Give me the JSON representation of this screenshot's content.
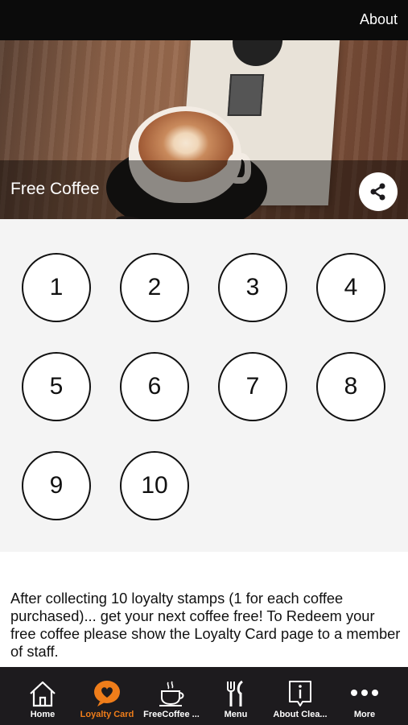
{
  "header": {
    "about_label": "About"
  },
  "hero": {
    "title": "Free Coffee",
    "share_icon": "share-icon"
  },
  "stamps": [
    "1",
    "2",
    "3",
    "4",
    "5",
    "6",
    "7",
    "8",
    "9",
    "10"
  ],
  "description": "After collecting 10 loyalty stamps (1 for each coffee purchased)... get your next coffee free! To Redeem your free coffee please show the Loyalty Card page to a member of staff.",
  "tab_bar": {
    "active_color": "#ef7d1a",
    "tabs": [
      {
        "label": "Home",
        "icon": "home-icon"
      },
      {
        "label": "Loyalty Card",
        "icon": "heart-bubble-icon",
        "active": true
      },
      {
        "label": "FreeCoffee ...",
        "icon": "coffee-cup-icon"
      },
      {
        "label": "Menu",
        "icon": "fork-knife-icon"
      },
      {
        "label": "About Clea...",
        "icon": "info-icon"
      },
      {
        "label": "More",
        "icon": "more-dots-icon"
      }
    ]
  }
}
